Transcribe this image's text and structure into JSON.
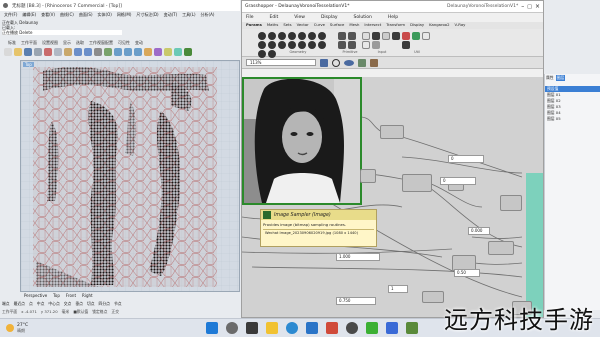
{
  "rhino": {
    "title": "无标题 [B8.3] - [Rhinoceros 7 Commercial - [Top]]",
    "menu": [
      "文件(F)",
      "编辑(E)",
      "查看(V)",
      "曲线(C)",
      "曲面(S)",
      "实体(O)",
      "网格(M)",
      "尺寸标注(D)",
      "变动(T)",
      "工具(L)",
      "分析(A)",
      "渲染(R)",
      "面板(P)",
      "说明(H)"
    ],
    "command_history": "正在载入 Delaunay",
    "command_prompt": "已载入:",
    "command_line": "正在播放 Delete",
    "tabs": [
      "标准",
      "工作平面",
      "设置视图",
      "显示",
      "选取",
      "工作视窗配置",
      "可见性",
      "变动",
      "曲线工具",
      "曲面工具",
      "实体工具",
      "网格工具",
      "渲染工具",
      "出图",
      "V7 的新功能"
    ],
    "viewport_label": "Top",
    "viewport_tabs": [
      "Perspective",
      "Top",
      "Front",
      "Right"
    ],
    "osnap": [
      "端点",
      "最近点",
      "点",
      "中点",
      "中心点",
      "交点",
      "垂点",
      "切点",
      "四分点",
      "节点",
      "顶点",
      "投影",
      "停用"
    ],
    "status": [
      "工作平面",
      "x -4.071",
      "y 371.20",
      "z",
      "毫米",
      "■默认值",
      "锁定格点",
      "正交",
      "平面模式",
      "物件锁点",
      "智慧轨迹",
      "操作轴",
      "记录建构历史",
      "过滤器",
      "距离上次保存的时间(分钟): 1"
    ],
    "right_panel": {
      "tabs": [
        "属性",
        "图层",
        "显示",
        "说明"
      ],
      "title": "图层",
      "layers": [
        "预设值",
        "图层 01",
        "图层 02",
        "图层 03",
        "图层 04",
        "图层 05"
      ]
    }
  },
  "grasshopper": {
    "title": "Grasshopper - DelaunayVoronoiTesselationV1*",
    "title_right": "DelaunayVoronoiTesselationV1*",
    "menu": [
      "File",
      "Edit",
      "View",
      "Display",
      "Solution",
      "Help"
    ],
    "tabs": [
      "Params",
      "Maths",
      "Sets",
      "Vector",
      "Curve",
      "Surface",
      "Mesh",
      "Intersect",
      "Transform",
      "Display",
      "Kangaroo2",
      "V-Ray"
    ],
    "sub_groups": [
      "Geometry",
      "Primitive",
      "Input",
      "Util"
    ],
    "zoom": "113%",
    "tooltip": {
      "title": "Image Sampler (Image)",
      "subtitle": "Provides image (bitmap) sampling routines.",
      "path": "Wechat Image_20230906020919.jpg (1080 x 1440)"
    },
    "panels": {
      "p1": "0",
      "p2": "0",
      "p3": "1.000",
      "p4": "0.50",
      "p5": "0.000",
      "p6": "0.750",
      "p7": "1"
    }
  },
  "taskbar": {
    "weather_temp": "27°C",
    "weather_desc": "晴朗"
  },
  "watermark": "远方科技手游",
  "colors": {
    "gh_canvas": "#d1d1d1",
    "gh_teal": "#6fd1b8",
    "gh_tooltip": "#fff6c8",
    "rhino_bg": "#d3dae3",
    "voronoi": "#b86b6b"
  }
}
